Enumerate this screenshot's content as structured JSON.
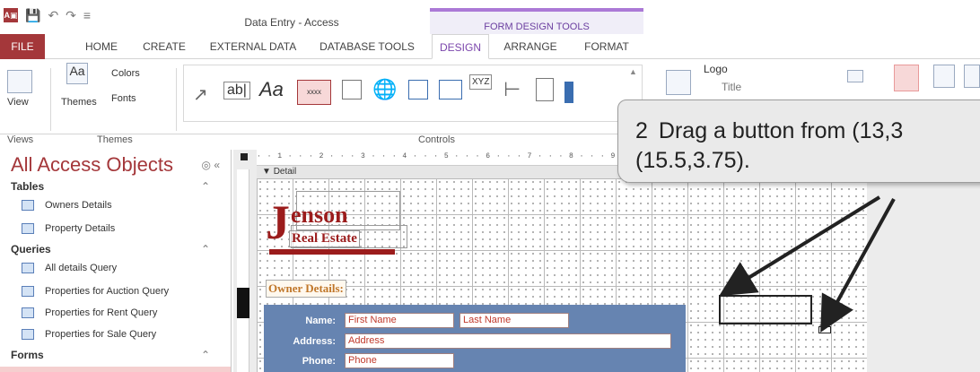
{
  "title_bar": {
    "app_badge": "A▣",
    "window_title": "Data Entry - Access",
    "context_header": "FORM DESIGN TOOLS"
  },
  "tabs": [
    {
      "label": "FILE"
    },
    {
      "label": "HOME"
    },
    {
      "label": "CREATE"
    },
    {
      "label": "EXTERNAL DATA"
    },
    {
      "label": "DATABASE TOOLS"
    },
    {
      "label": "DESIGN"
    },
    {
      "label": "ARRANGE"
    },
    {
      "label": "FORMAT"
    }
  ],
  "ribbon": {
    "view_label": "View",
    "themes_label": "Themes",
    "colors_label": "Colors",
    "fonts_label": "Fonts",
    "groups": {
      "views": "Views",
      "themes": "Themes",
      "controls": "Controls"
    },
    "controls": {
      "textbox": "ab|",
      "label": "Aa",
      "button": "xxxx",
      "chart": "XYZ"
    },
    "logo_label": "Logo",
    "title_label": "Title"
  },
  "nav": {
    "title": "All Access Objects",
    "sections": [
      {
        "label": "Tables",
        "items": [
          "Owners Details",
          "Property Details"
        ]
      },
      {
        "label": "Queries",
        "items": [
          "All details Query",
          "Properties for Auction Query",
          "Properties for Rent Query",
          "Properties for Sale Query"
        ]
      },
      {
        "label": "Forms",
        "items": []
      }
    ]
  },
  "design": {
    "ruler_text": "· · 1 · · · 2 · · · 3 · · · 4 · · · 5 · · · 6 · · · 7 · · · 8 · · · 9 · · · 10",
    "section": "Detail",
    "logo_letter": "J",
    "logo_name": "enson",
    "logo_sub": "Real Estate",
    "owner_label": "Owner Details:",
    "fields": {
      "name_label": "Name:",
      "first_name": "First Name",
      "last_name": "Last Name",
      "address_label": "Address:",
      "address": "Address",
      "phone_label": "Phone:",
      "phone": "Phone"
    }
  },
  "callout": {
    "number": "2",
    "line1": "Drag a button from (13,3",
    "line2": "(15.5,3.75)."
  },
  "colors": {
    "file_tab": "#a4373a",
    "context_purple": "#7b46ac",
    "form_panel": "#6684b1",
    "logo_red": "#9b1c1c"
  }
}
